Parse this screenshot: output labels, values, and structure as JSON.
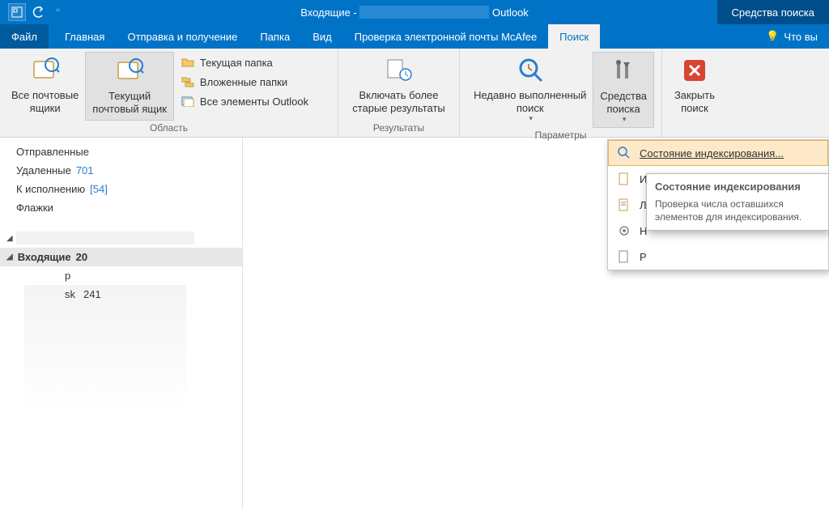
{
  "titlebar": {
    "prefix": "Входящие - ",
    "suffix": " Outlook",
    "tools_tab": "Средства поиска"
  },
  "tabs": {
    "file": "Файл",
    "home": "Главная",
    "sendreceive": "Отправка и получение",
    "folder": "Папка",
    "view": "Вид",
    "mcafee": "Проверка электронной почты McAfee",
    "search": "Поиск",
    "tellme": "Что вы"
  },
  "ribbon": {
    "scope": {
      "all_mailboxes": "Все почтовые\nящики",
      "current_mailbox": "Текущий\nпочтовый ящик",
      "current_folder": "Текущая папка",
      "subfolders": "Вложенные папки",
      "all_outlook": "Все элементы Outlook",
      "group_label": "Область"
    },
    "results": {
      "include_older": "Включать более\nстарые результаты",
      "group_label": "Результаты"
    },
    "options": {
      "recent_searches": "Недавно выполненный\nпоиск",
      "search_tools": "Средства\nпоиска",
      "group_label": "Параметры"
    },
    "close": {
      "close_search": "Закрыть\nпоиск"
    }
  },
  "sidebar": {
    "sent": {
      "label": "Отправленные"
    },
    "deleted": {
      "label": "Удаленные",
      "count": "701"
    },
    "followup": {
      "label": "К исполнению",
      "count": "[54]"
    },
    "flags": {
      "label": "Флажки"
    },
    "inbox": {
      "label": "Входящие",
      "count": "20"
    },
    "sub1": {
      "suffix": "р"
    },
    "sub2": {
      "suffix": "sk",
      "count": "241"
    }
  },
  "dropdown": {
    "indexing_status": "Состояние индексирования...",
    "item_r": "И",
    "item_l": "Л",
    "item_n": "Н",
    "item_p": "Р"
  },
  "tooltip": {
    "title": "Состояние индексирования",
    "body": "Проверка числа оставшихся элементов для индексирования."
  }
}
